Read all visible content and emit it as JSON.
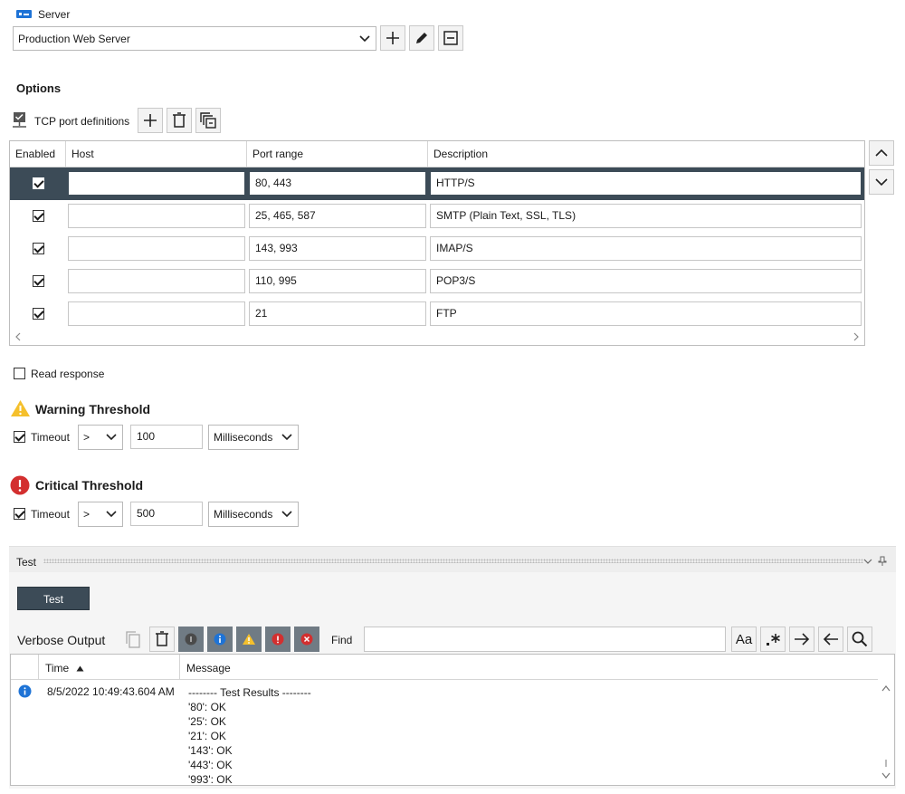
{
  "server": {
    "label": "Server",
    "selected": "Production Web Server"
  },
  "options": {
    "title": "Options",
    "tcp_label": "TCP port definitions",
    "columns": [
      "Enabled",
      "Host",
      "Port range",
      "Description"
    ],
    "rows": [
      {
        "enabled": true,
        "host": "",
        "ports": "80, 443",
        "description": "HTTP/S"
      },
      {
        "enabled": true,
        "host": "",
        "ports": "25, 465, 587",
        "description": "SMTP (Plain Text, SSL, TLS)"
      },
      {
        "enabled": true,
        "host": "",
        "ports": "143, 993",
        "description": "IMAP/S"
      },
      {
        "enabled": true,
        "host": "",
        "ports": "110, 995",
        "description": "POP3/S"
      },
      {
        "enabled": true,
        "host": "",
        "ports": "21",
        "description": "FTP"
      }
    ],
    "read_response": "Read response"
  },
  "warning": {
    "title": "Warning Threshold",
    "timeout_label": "Timeout",
    "operator": ">",
    "value": "100",
    "unit": "Milliseconds"
  },
  "critical": {
    "title": "Critical Threshold",
    "timeout_label": "Timeout",
    "operator": ">",
    "value": "500",
    "unit": "Milliseconds"
  },
  "test": {
    "panel_title": "Test",
    "button": "Test",
    "verbose_label": "Verbose Output",
    "find_label": "Find",
    "find_value": "",
    "find_case": "Aa",
    "columns": [
      "Time",
      "Message"
    ],
    "log": {
      "time": "8/5/2022 10:49:43.604 AM",
      "lines": [
        "-------- Test Results --------",
        "'80': OK",
        "'25': OK",
        "'21': OK",
        "'143': OK",
        "'443': OK",
        "'993': OK"
      ]
    }
  },
  "colors": {
    "selected_row": "#3c4b57",
    "warning": "#f5c02c",
    "critical": "#d32f2f",
    "info": "#1e73d6",
    "test_button": "#3c4b57"
  }
}
